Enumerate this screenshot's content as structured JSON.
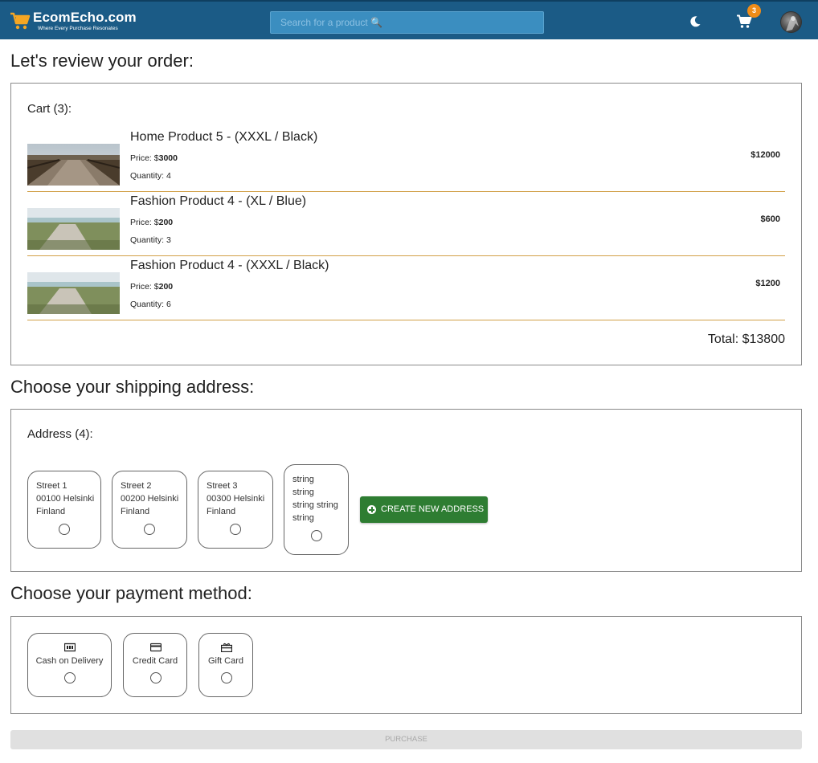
{
  "header": {
    "logo_title": "EcomEcho.com",
    "logo_tagline": "Where Every Purchase Resonates",
    "search_placeholder": "Search for a product 🔍",
    "cart_count": "3",
    "icons": [
      "cart-logo-icon",
      "moon-icon",
      "shopping-cart-icon",
      "avatar"
    ],
    "colors": {
      "header_bg": "#1b5b86",
      "badge": "#f08c18"
    }
  },
  "review": {
    "heading": "Let's review your order:",
    "cart_label": "Cart (3):",
    "items": [
      {
        "name": "Home Product 5 - (XXXL / Black)",
        "price_prefix": "Price: $",
        "price": "3000",
        "quantity": "Quantity: 4",
        "subtotal": "$12000"
      },
      {
        "name": "Fashion Product 4 - (XL / Blue)",
        "price_prefix": "Price: $",
        "price": "200",
        "quantity": "Quantity: 3",
        "subtotal": "$600"
      },
      {
        "name": "Fashion Product 4 - (XXXL / Black)",
        "price_prefix": "Price: $",
        "price": "200",
        "quantity": "Quantity: 6",
        "subtotal": "$1200"
      }
    ],
    "total": "Total: $13800"
  },
  "shipping": {
    "heading": "Choose your shipping address:",
    "address_label": "Address (4):",
    "addresses": [
      {
        "line1": "Street 1",
        "line2": "00100 Helsinki",
        "line3": "Finland"
      },
      {
        "line1": "Street 2",
        "line2": "00200 Helsinki",
        "line3": "Finland"
      },
      {
        "line1": "Street 3",
        "line2": "00300 Helsinki",
        "line3": "Finland"
      },
      {
        "line1": "string",
        "line2": "string",
        "line3": "string string",
        "line4": "string"
      }
    ],
    "create_button": "CREATE NEW ADDRESS"
  },
  "payment": {
    "heading": "Choose your payment method:",
    "methods": [
      {
        "label": "Cash on Delivery",
        "icon": "cash-icon"
      },
      {
        "label": "Credit Card",
        "icon": "credit-card-icon"
      },
      {
        "label": "Gift Card",
        "icon": "gift-card-icon"
      }
    ]
  },
  "purchase_button": "PURCHASE"
}
